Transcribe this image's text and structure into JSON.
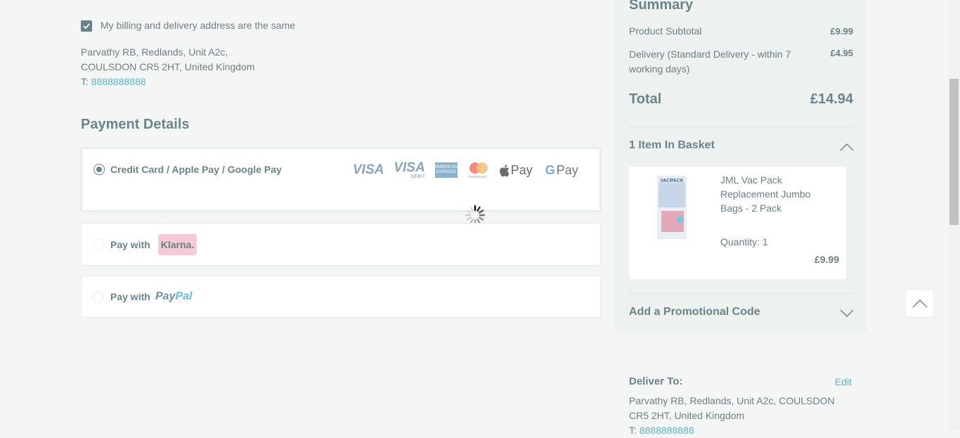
{
  "billing": {
    "same_label": "My billing and delivery address are the same",
    "same_checked": true,
    "address_line1": "Parvathy RB, Redlands, Unit A2c,",
    "address_line2": "COULSDON CR5 2HT, United Kingdom",
    "phone_prefix": "T:",
    "phone": "8888888888"
  },
  "payment": {
    "title": "Payment Details",
    "options": [
      {
        "label": "Credit Card / Apple Pay / Google Pay",
        "selected": true
      },
      {
        "label": "Pay with",
        "brand": "Klarna.",
        "selected": false
      },
      {
        "label": "Pay with",
        "brand_part1": "Pay",
        "brand_part2": "Pal",
        "selected": false
      }
    ],
    "card_logos": {
      "visa": "VISA",
      "visa_debit": "VISA",
      "visa_debit_sub": "DEBIT",
      "amex_line1": "AMERICAN",
      "amex_line2": "EXPRESS",
      "mastercard_text": "mastercard",
      "apple_pay": "Pay",
      "google_pay": "Pay",
      "google_g": "G"
    }
  },
  "summary": {
    "title": "Summary",
    "subtotal_label": "Product Subtotal",
    "subtotal_value": "£9.99",
    "delivery_label": "Delivery (Standard Delivery - within 7 working days)",
    "delivery_value": "£4.95",
    "total_label": "Total",
    "total_value": "£14.94",
    "basket_heading": "1 Item In Basket",
    "basket_items": [
      {
        "name": "JML Vac Pack Replacement Jumbo Bags - 2 Pack",
        "quantity": "Quantity: 1",
        "price": "£9.99",
        "image_text": "VACPACK"
      }
    ],
    "promo_label": "Add a Promotional Code"
  },
  "delivery": {
    "title": "Deliver To:",
    "edit_label": "Edit",
    "address": "Parvathy RB, Redlands, Unit A2c, COULSDON CR5 2HT, United Kingdom",
    "phone_prefix": "T:",
    "phone": "8888888888"
  },
  "colors": {
    "accent": "#6b8489",
    "link": "#5bb1c0",
    "klarna_pink": "#f7c8d6"
  }
}
